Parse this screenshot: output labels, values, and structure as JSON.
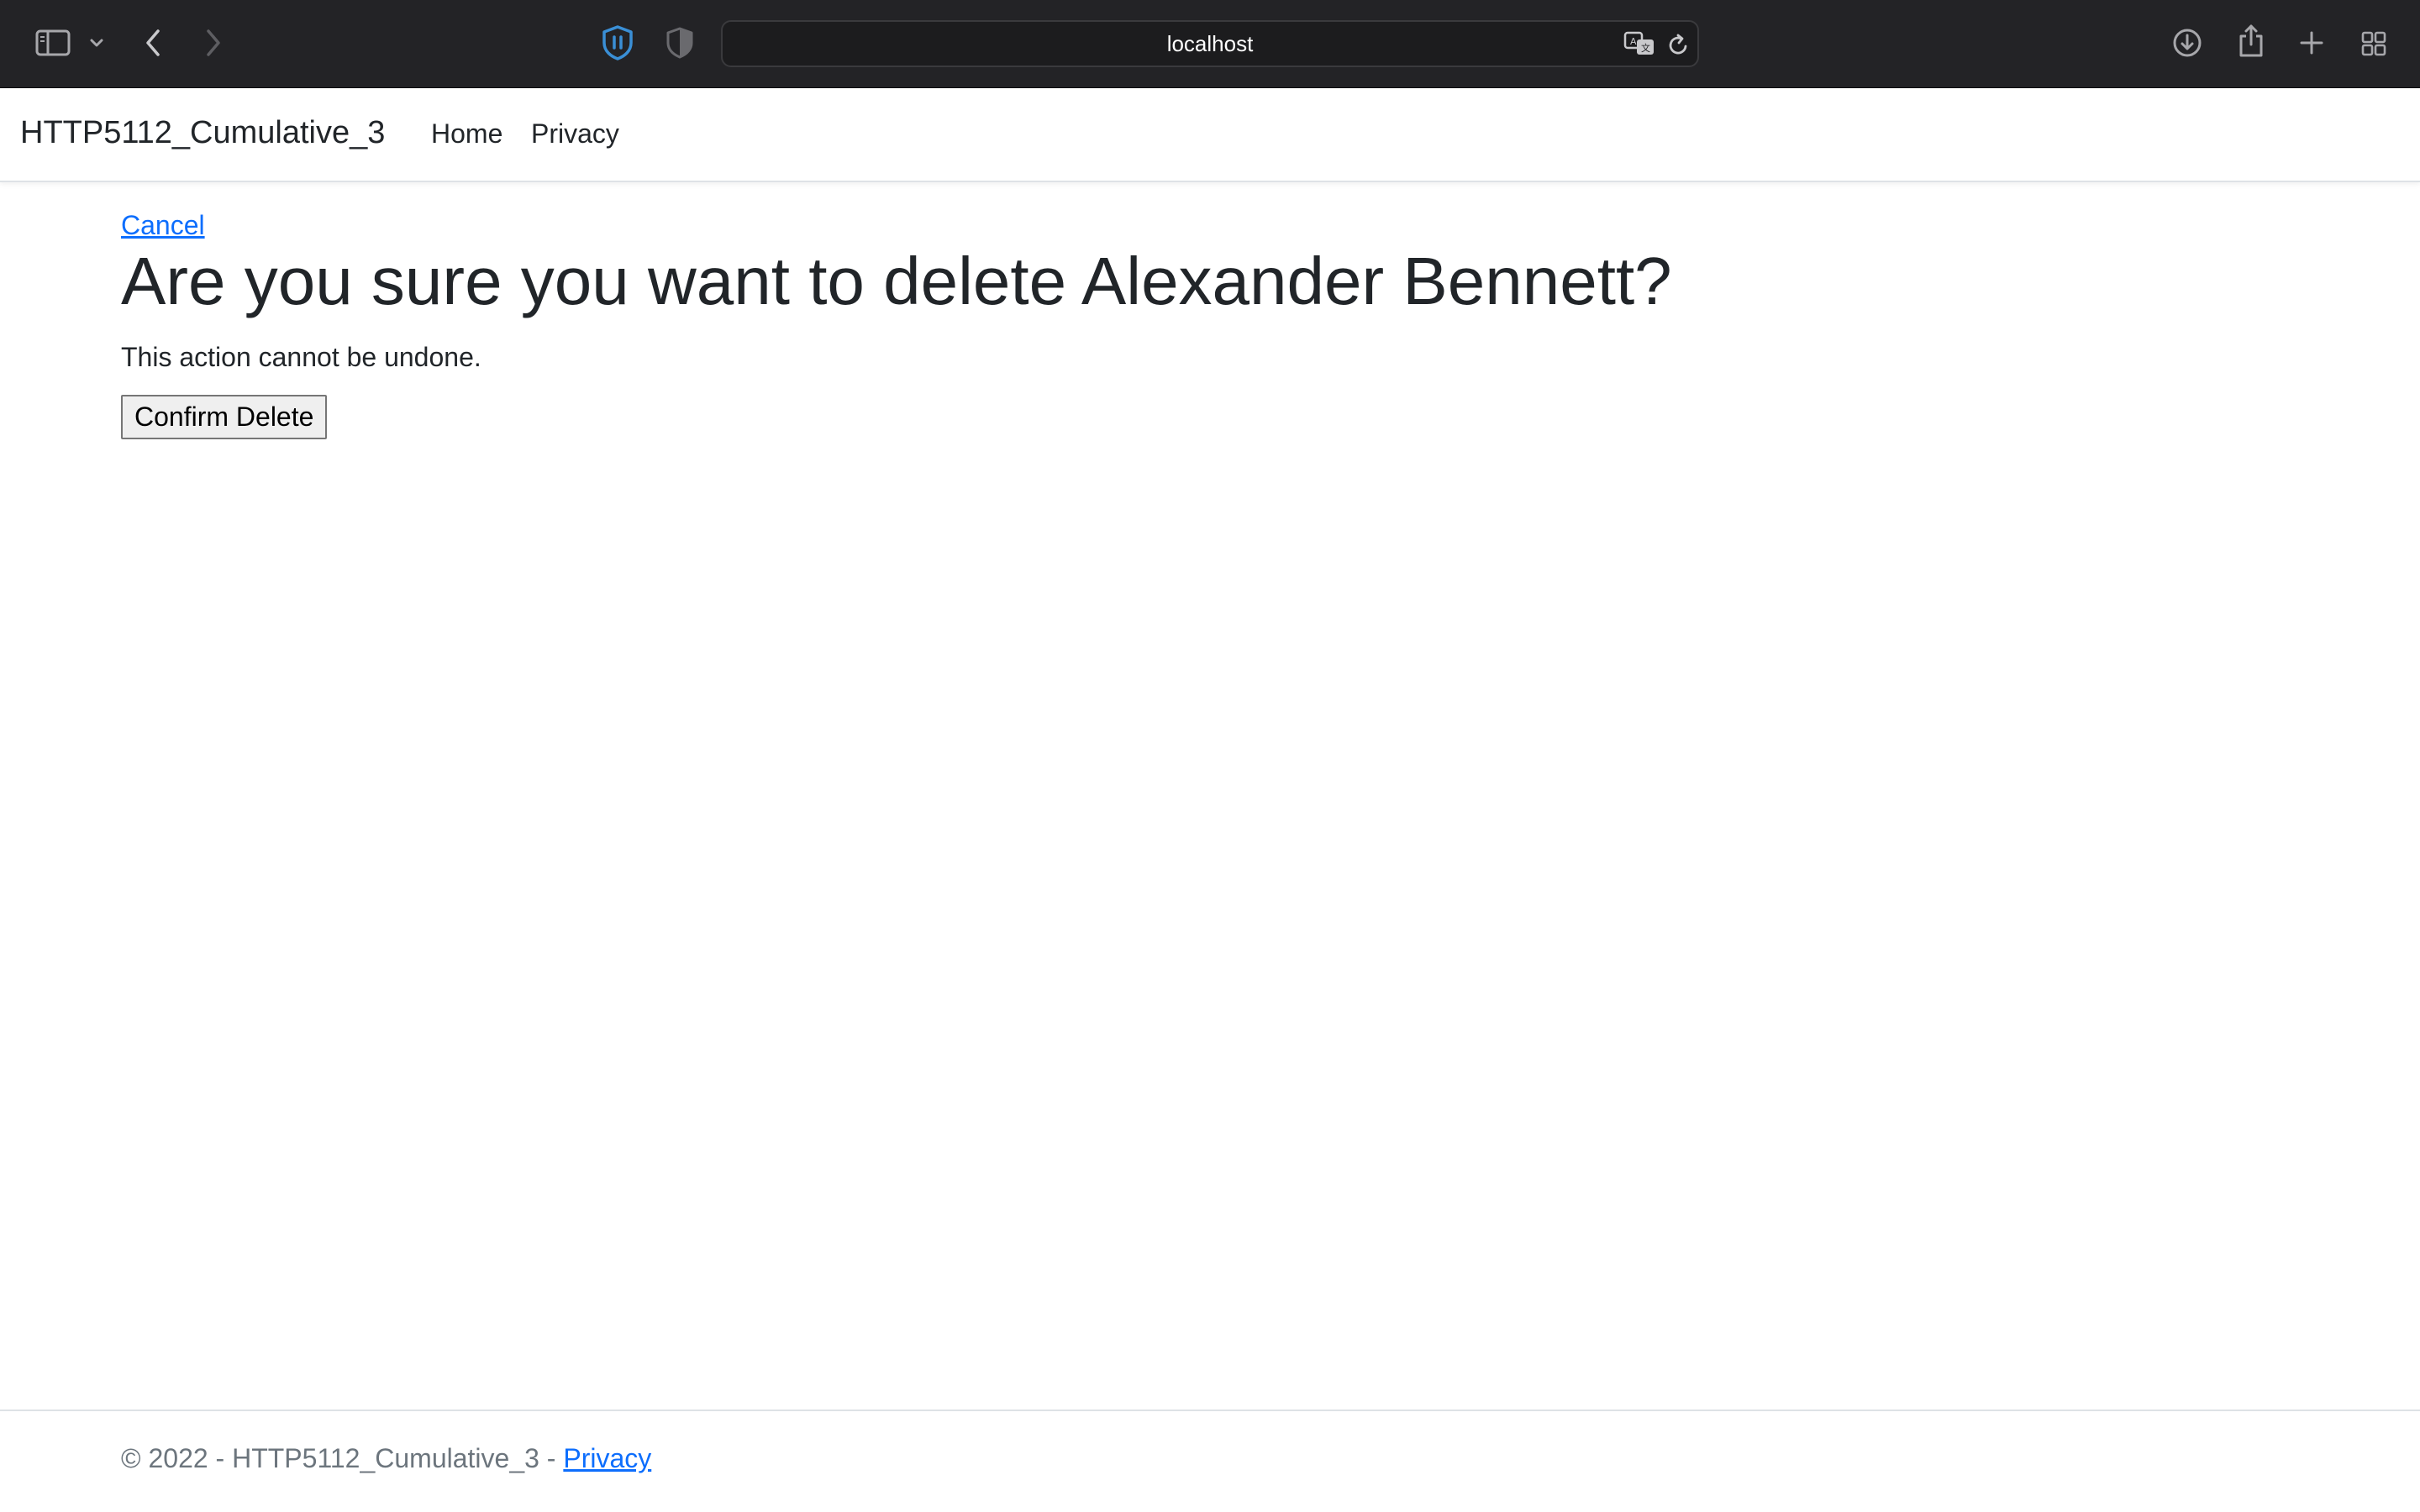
{
  "browser": {
    "url": "localhost",
    "icons": {
      "sidebar": "sidebar-icon",
      "sidebar_caret": "chevron-down-icon",
      "back": "chevron-left-icon",
      "forward": "chevron-right-icon",
      "password_manager": "shield-icon",
      "privacy_report": "half-shield-icon",
      "translate": "translate-icon",
      "reload": "reload-icon",
      "downloads": "download-icon",
      "share": "share-icon",
      "new_tab": "plus-icon",
      "tab_overview": "grid-icon"
    },
    "colors": {
      "chrome_bg": "#232326",
      "shield_accent": "#3a8fd6"
    }
  },
  "navbar": {
    "brand": "HTTP5112_Cumulative_3",
    "links": [
      {
        "label": "Home"
      },
      {
        "label": "Privacy"
      }
    ]
  },
  "main": {
    "cancel_label": "Cancel",
    "title": "Are you sure you want to delete Alexander Bennett?",
    "warning": "This action cannot be undone.",
    "confirm_label": "Confirm Delete"
  },
  "footer": {
    "copyright": "© 2022 - HTTP5112_Cumulative_3 - ",
    "privacy_label": "Privacy"
  },
  "colors": {
    "link": "#0d6efd",
    "text": "#212529",
    "muted": "#6c757d"
  }
}
